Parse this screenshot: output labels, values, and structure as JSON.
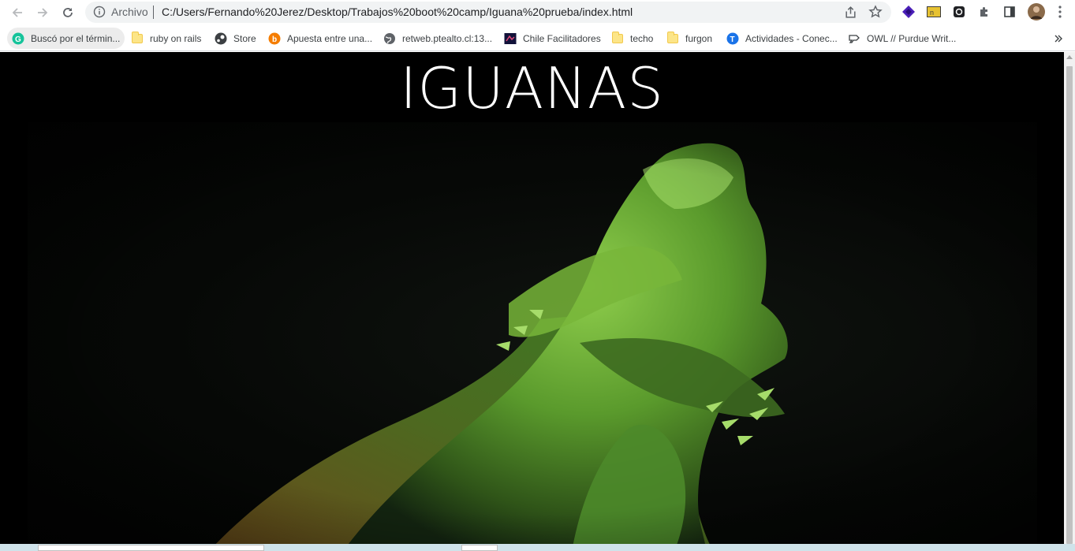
{
  "browser": {
    "omnibox": {
      "security_label": "Archivo",
      "url": "C:/Users/Fernando%20Jerez/Desktop/Trabajos%20boot%20camp/Iguana%20prueba/index.html"
    },
    "bookmarks": [
      {
        "label": "Buscó por el térmi​n...",
        "icon": "grammarly-icon"
      },
      {
        "label": "ruby on rails",
        "icon": "folder-icon"
      },
      {
        "label": "Store",
        "icon": "steam-icon"
      },
      {
        "label": "Apuesta entre una...",
        "icon": "blogger-icon"
      },
      {
        "label": "retweb.ptealto.cl:13...",
        "icon": "globe-icon"
      },
      {
        "label": "Chile Facilitadores",
        "icon": "site-icon"
      },
      {
        "label": "techo",
        "icon": "folder-icon"
      },
      {
        "label": "furgon",
        "icon": "folder-icon"
      },
      {
        "label": "Actividades - Conec...",
        "icon": "t-icon"
      },
      {
        "label": "OWL // Purdue Writ...",
        "icon": "owl-icon"
      }
    ]
  },
  "page": {
    "title": "IGUANAS",
    "hero_subject": "green-lizard-photo"
  },
  "colors": {
    "page_background": "#000000",
    "title_color": "#ffffff",
    "lizard_green": "#6fb23a"
  }
}
